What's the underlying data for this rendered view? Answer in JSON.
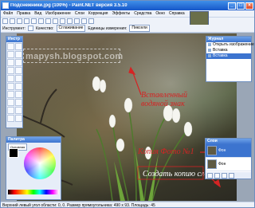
{
  "window": {
    "title": "Подснежники.jpg (100%) - Paint.NET версия 3.5.10"
  },
  "menu": [
    "Файл",
    "Правка",
    "Вид",
    "Изображение",
    "Слои",
    "Коррекция",
    "Эффекты",
    "Средства",
    "Окно",
    "Справка"
  ],
  "toolbar2": {
    "tool_label": "Инструмент:",
    "quality_label": "Качество:",
    "quality_value": "Сглаживание",
    "units_label": "Единицы измерения:",
    "units_value": "Пиксели"
  },
  "watermark": {
    "text": "mapysh.blogspot.com"
  },
  "annotations": {
    "watermark_note": "Вставленный водяной знак",
    "copy_note": "Копия Фото №1",
    "create_copy_note": "Создать копию слоя"
  },
  "panels": {
    "tools_title": "Инстр",
    "history_title": "Журнал",
    "history_items": [
      "Открыть изображение",
      "Вставка",
      "Вставка"
    ],
    "palette_title": "Палитра",
    "palette_more": "Основная",
    "layers_title": "Слои",
    "layers": [
      "Фон",
      "Фон"
    ]
  },
  "status": {
    "text": "Верхний левый угол области: 0, 0. Размер прямоугольника: 490 x 93. Площадь: 45"
  },
  "colors": {
    "accent": "#3c74cf",
    "annotation": "#d42424"
  }
}
